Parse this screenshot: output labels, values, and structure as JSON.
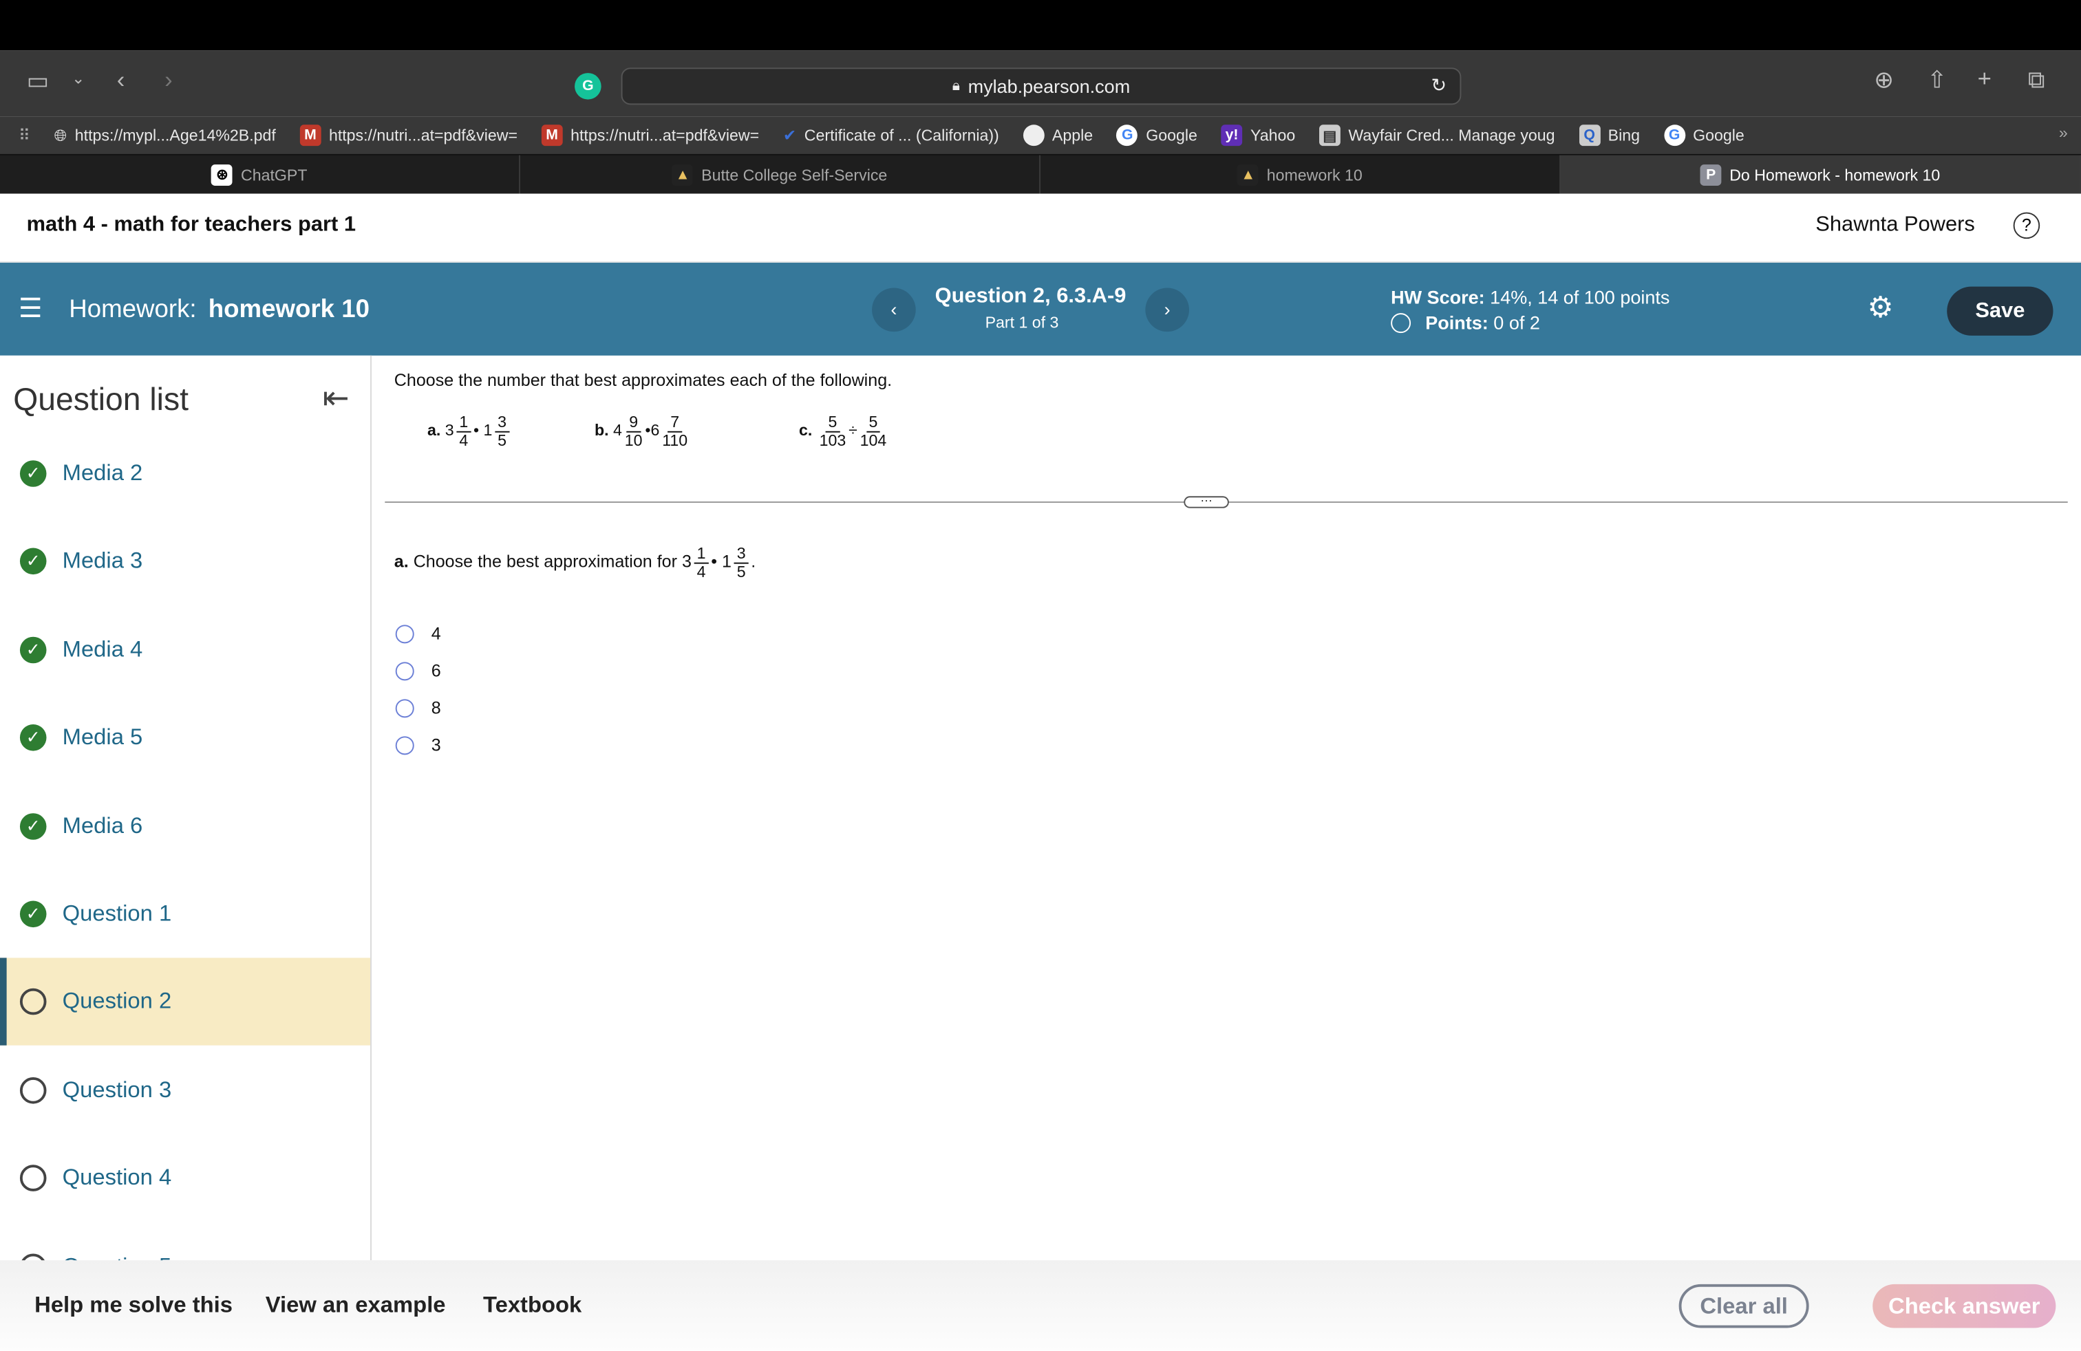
{
  "browser": {
    "url": "mylab.pearson.com",
    "bookmarks": [
      {
        "label": "https://mypl...Age14%2B.pdf",
        "icon": "globe-icon"
      },
      {
        "label": "https://nutri...at=pdf&view=",
        "icon": "m-icon"
      },
      {
        "label": "https://nutri...at=pdf&view=",
        "icon": "m-icon"
      },
      {
        "label": "Certificate of ... (California))",
        "icon": "check-icon"
      },
      {
        "label": "Apple",
        "icon": "apple-icon"
      },
      {
        "label": "Google",
        "icon": "google-icon"
      },
      {
        "label": "Yahoo",
        "icon": "yahoo-icon"
      },
      {
        "label": "Wayfair Cred... Manage youg",
        "icon": "card-icon"
      },
      {
        "label": "Bing",
        "icon": "bing-icon"
      },
      {
        "label": "Google",
        "icon": "google-icon"
      }
    ],
    "tabs": [
      {
        "label": "ChatGPT",
        "active": false
      },
      {
        "label": "Butte College Self-Service",
        "active": false
      },
      {
        "label": "homework 10",
        "active": false
      },
      {
        "label": "Do Homework - homework 10",
        "active": true
      }
    ]
  },
  "course": {
    "title": "math 4 - math for teachers part 1",
    "user": "Shawnta Powers"
  },
  "header": {
    "homework_label": "Homework:",
    "homework_name": "homework 10",
    "question": "Question 2, 6.3.A-9",
    "part": "Part 1 of 3",
    "hw_score_label": "HW Score:",
    "hw_score": "14%, 14 of 100 points",
    "points_label": "Points:",
    "points": "0 of 2",
    "save": "Save",
    "color": "#36789a"
  },
  "sidebar": {
    "title": "Question list",
    "items": [
      {
        "label": "Media 2",
        "status": "complete"
      },
      {
        "label": "Media 3",
        "status": "complete"
      },
      {
        "label": "Media 4",
        "status": "complete"
      },
      {
        "label": "Media 5",
        "status": "complete"
      },
      {
        "label": "Media 6",
        "status": "complete"
      },
      {
        "label": "Question 1",
        "status": "complete"
      },
      {
        "label": "Question 2",
        "status": "current"
      },
      {
        "label": "Question 3",
        "status": "incomplete"
      },
      {
        "label": "Question 4",
        "status": "incomplete"
      },
      {
        "label": "Question 5",
        "status": "incomplete"
      }
    ]
  },
  "question": {
    "instruction": "Choose the number that best approximates each of the following.",
    "parts": {
      "a": {
        "label": "a.",
        "w1": "3",
        "n1": "1",
        "d1": "4",
        "op": "•",
        "w2": "1",
        "n2": "3",
        "d2": "5"
      },
      "b": {
        "label": "b.",
        "w1": "4",
        "n1": "9",
        "d1": "10",
        "op": "•",
        "w2": "6",
        "n2": "7",
        "d2": "110"
      },
      "c": {
        "label": "c.",
        "n1": "5",
        "d1": "103",
        "op": "÷",
        "n2": "5",
        "d2": "104"
      }
    },
    "sub_label": "a.",
    "sub_text": "Choose the best approximation for",
    "period": ".",
    "options": [
      "4",
      "6",
      "8",
      "3"
    ]
  },
  "footer": {
    "help": "Help me solve this",
    "example": "View an example",
    "textbook": "Textbook",
    "clear": "Clear all",
    "check": "Check answer"
  }
}
